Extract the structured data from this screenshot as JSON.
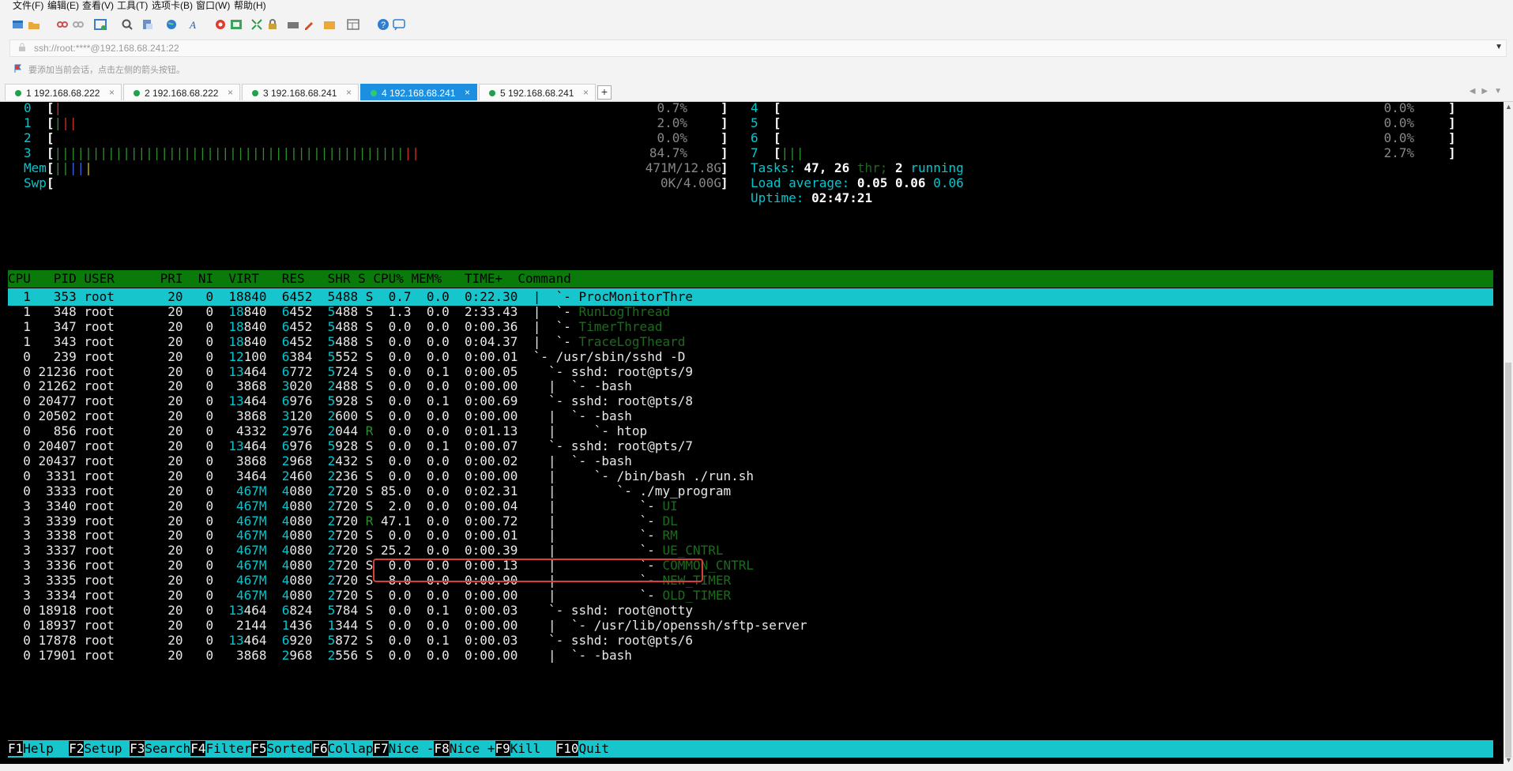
{
  "menu": [
    "文件(F)",
    "编辑(E)",
    "查看(V)",
    "工具(T)",
    "选项卡(B)",
    "窗口(W)",
    "帮助(H)"
  ],
  "address": {
    "text": "ssh://root:****@192.168.68.241:22"
  },
  "hint": "要添加当前会话，点击左侧的箭头按钮。",
  "tabs": [
    {
      "label": "1 192.168.68.222",
      "active": false
    },
    {
      "label": "2 192.168.68.222",
      "active": false
    },
    {
      "label": "3 192.168.68.241",
      "active": false
    },
    {
      "label": "4 192.168.68.241",
      "active": true
    },
    {
      "label": "5 192.168.68.241",
      "active": false
    }
  ],
  "close_glyph": "×",
  "add_tab_glyph": "+",
  "htop": {
    "cpus_left": [
      {
        "id": "0",
        "bars": 1,
        "color": "r",
        "value": "0.7%"
      },
      {
        "id": "1",
        "bars": 3,
        "color": "mix",
        "value": "2.0%"
      },
      {
        "id": "2",
        "bars": 0,
        "color": "g",
        "value": "0.0%"
      },
      {
        "id": "3",
        "bars": 48,
        "color": "g",
        "value": "84.7%"
      }
    ],
    "cpus_right": [
      {
        "id": "4",
        "value": "0.0%"
      },
      {
        "id": "5",
        "value": "0.0%"
      },
      {
        "id": "6",
        "value": "0.0%"
      },
      {
        "id": "7",
        "value": "2.7%"
      }
    ],
    "mem": {
      "label": "Mem",
      "value": "471M/12.8G"
    },
    "swp": {
      "label": "Swp",
      "value": "0K/4.00G"
    },
    "tasks": {
      "label": "Tasks:",
      "count": "47,",
      "threads": "26",
      "thr": "thr;",
      "running_count": "2",
      "running": "running"
    },
    "load": {
      "label": "Load average:",
      "l1": "0.05",
      "l5": "0.06",
      "l15": "0.06"
    },
    "uptime": {
      "label": "Uptime:",
      "value": "02:47:21"
    },
    "header": "CPU   PID USER      PRI  NI  VIRT   RES   SHR S CPU% MEM%   TIME+  Command",
    "rows": [
      {
        "cpu": "1",
        "pid": "353",
        "user": "root",
        "pri": "20",
        "ni": "0",
        "virt": "18840",
        "res": "6452",
        "shr": "5488",
        "s": "S",
        "cpuPct": "0.7",
        "mem": "0.0",
        "time": "0:22.30",
        "tree": "|  `- ",
        "cmd": "ProcMonitorThre",
        "cmdColor": "sel"
      },
      {
        "cpu": "1",
        "pid": "348",
        "user": "root",
        "pri": "20",
        "ni": "0",
        "virt": "18840",
        "res": "6452",
        "shr": "5488",
        "s": "S",
        "cpuPct": "1.3",
        "mem": "0.0",
        "time": "2:33.43",
        "tree": "|  `- ",
        "cmd": "RunLogThread",
        "cmdColor": "dg"
      },
      {
        "cpu": "1",
        "pid": "347",
        "user": "root",
        "pri": "20",
        "ni": "0",
        "virt": "18840",
        "res": "6452",
        "shr": "5488",
        "s": "S",
        "cpuPct": "0.0",
        "mem": "0.0",
        "time": "0:00.36",
        "tree": "|  `- ",
        "cmd": "TimerThread",
        "cmdColor": "dg"
      },
      {
        "cpu": "1",
        "pid": "343",
        "user": "root",
        "pri": "20",
        "ni": "0",
        "virt": "18840",
        "res": "6452",
        "shr": "5488",
        "s": "S",
        "cpuPct": "0.0",
        "mem": "0.0",
        "time": "0:04.37",
        "tree": "|  `- ",
        "cmd": "TraceLogTheard",
        "cmdColor": "dg"
      },
      {
        "cpu": "0",
        "pid": "239",
        "user": "root",
        "pri": "20",
        "ni": "0",
        "virt": "12100",
        "res": "6384",
        "shr": "5552",
        "s": "S",
        "cpuPct": "0.0",
        "mem": "0.0",
        "time": "0:00.01",
        "tree": "`- ",
        "cmd": "/usr/sbin/sshd -D",
        "cmdColor": "w"
      },
      {
        "cpu": "0",
        "pid": "21236",
        "user": "root",
        "pri": "20",
        "ni": "0",
        "virt": "13464",
        "res": "6772",
        "shr": "5724",
        "s": "S",
        "cpuPct": "0.0",
        "mem": "0.1",
        "time": "0:00.05",
        "tree": "  `- ",
        "cmd": "sshd: root@pts/9",
        "cmdColor": "w"
      },
      {
        "cpu": "0",
        "pid": "21262",
        "user": "root",
        "pri": "20",
        "ni": "0",
        "virt": "3868",
        "res": "3020",
        "shr": "2488",
        "s": "S",
        "cpuPct": "0.0",
        "mem": "0.0",
        "time": "0:00.00",
        "tree": "  |  `- ",
        "cmd": "-bash",
        "cmdColor": "w"
      },
      {
        "cpu": "0",
        "pid": "20477",
        "user": "root",
        "pri": "20",
        "ni": "0",
        "virt": "13464",
        "res": "6976",
        "shr": "5928",
        "s": "S",
        "cpuPct": "0.0",
        "mem": "0.1",
        "time": "0:00.69",
        "tree": "  `- ",
        "cmd": "sshd: root@pts/8",
        "cmdColor": "w"
      },
      {
        "cpu": "0",
        "pid": "20502",
        "user": "root",
        "pri": "20",
        "ni": "0",
        "virt": "3868",
        "res": "3120",
        "shr": "2600",
        "s": "S",
        "cpuPct": "0.0",
        "mem": "0.0",
        "time": "0:00.00",
        "tree": "  |  `- ",
        "cmd": "-bash",
        "cmdColor": "w"
      },
      {
        "cpu": "0",
        "pid": "856",
        "user": "root",
        "pri": "20",
        "ni": "0",
        "virt": "4332",
        "res": "2976",
        "shr": "2044",
        "s": "R",
        "cpuPct": "0.0",
        "mem": "0.0",
        "time": "0:01.13",
        "tree": "  |     `- ",
        "cmd": "htop",
        "cmdColor": "w"
      },
      {
        "cpu": "0",
        "pid": "20407",
        "user": "root",
        "pri": "20",
        "ni": "0",
        "virt": "13464",
        "res": "6976",
        "shr": "5928",
        "s": "S",
        "cpuPct": "0.0",
        "mem": "0.1",
        "time": "0:00.07",
        "tree": "  `- ",
        "cmd": "sshd: root@pts/7",
        "cmdColor": "w"
      },
      {
        "cpu": "0",
        "pid": "20437",
        "user": "root",
        "pri": "20",
        "ni": "0",
        "virt": "3868",
        "res": "2968",
        "shr": "2432",
        "s": "S",
        "cpuPct": "0.0",
        "mem": "0.0",
        "time": "0:00.02",
        "tree": "  |  `- ",
        "cmd": "-bash",
        "cmdColor": "w"
      },
      {
        "cpu": "0",
        "pid": "3331",
        "user": "root",
        "pri": "20",
        "ni": "0",
        "virt": "3464",
        "res": "2460",
        "shr": "2236",
        "s": "S",
        "cpuPct": "0.0",
        "mem": "0.0",
        "time": "0:00.00",
        "tree": "  |     `- ",
        "cmd": "/bin/bash ./run.sh",
        "cmdColor": "w"
      },
      {
        "cpu": "0",
        "pid": "3333",
        "user": "root",
        "pri": "20",
        "ni": "0",
        "virt": "467M",
        "res": "4080",
        "shr": "2720",
        "s": "S",
        "cpuPct": "85.0",
        "mem": "0.0",
        "time": "0:02.31",
        "tree": "  |        `- ",
        "cmd": "./my_program",
        "cmdColor": "w"
      },
      {
        "cpu": "3",
        "pid": "3340",
        "user": "root",
        "pri": "20",
        "ni": "0",
        "virt": "467M",
        "res": "4080",
        "shr": "2720",
        "s": "S",
        "cpuPct": "2.0",
        "mem": "0.0",
        "time": "0:00.04",
        "tree": "  |           `- ",
        "cmd": "UI",
        "cmdColor": "dg"
      },
      {
        "cpu": "3",
        "pid": "3339",
        "user": "root",
        "pri": "20",
        "ni": "0",
        "virt": "467M",
        "res": "4080",
        "shr": "2720",
        "s": "R",
        "cpuPct": "47.1",
        "mem": "0.0",
        "time": "0:00.72",
        "tree": "  |           `- ",
        "cmd": "DL",
        "cmdColor": "dg"
      },
      {
        "cpu": "3",
        "pid": "3338",
        "user": "root",
        "pri": "20",
        "ni": "0",
        "virt": "467M",
        "res": "4080",
        "shr": "2720",
        "s": "S",
        "cpuPct": "0.0",
        "mem": "0.0",
        "time": "0:00.01",
        "tree": "  |           `- ",
        "cmd": "RM",
        "cmdColor": "dg"
      },
      {
        "cpu": "3",
        "pid": "3337",
        "user": "root",
        "pri": "20",
        "ni": "0",
        "virt": "467M",
        "res": "4080",
        "shr": "2720",
        "s": "S",
        "cpuPct": "25.2",
        "mem": "0.0",
        "time": "0:00.39",
        "tree": "  |           `- ",
        "cmd": "UE_CNTRL",
        "cmdColor": "dg"
      },
      {
        "cpu": "3",
        "pid": "3336",
        "user": "root",
        "pri": "20",
        "ni": "0",
        "virt": "467M",
        "res": "4080",
        "shr": "2720",
        "s": "S",
        "cpuPct": "0.0",
        "mem": "0.0",
        "time": "0:00.13",
        "tree": "  |           `- ",
        "cmd": "COMMON_CNTRL",
        "cmdColor": "dg"
      },
      {
        "cpu": "3",
        "pid": "3335",
        "user": "root",
        "pri": "20",
        "ni": "0",
        "virt": "467M",
        "res": "4080",
        "shr": "2720",
        "s": "S",
        "cpuPct": "8.0",
        "mem": "0.0",
        "time": "0:00.90",
        "tree": "  |           `- ",
        "cmd": "NEW_TIMER",
        "cmdColor": "dg"
      },
      {
        "cpu": "3",
        "pid": "3334",
        "user": "root",
        "pri": "20",
        "ni": "0",
        "virt": "467M",
        "res": "4080",
        "shr": "2720",
        "s": "S",
        "cpuPct": "0.0",
        "mem": "0.0",
        "time": "0:00.00",
        "tree": "  |           `- ",
        "cmd": "OLD_TIMER",
        "cmdColor": "dg"
      },
      {
        "cpu": "0",
        "pid": "18918",
        "user": "root",
        "pri": "20",
        "ni": "0",
        "virt": "13464",
        "res": "6824",
        "shr": "5784",
        "s": "S",
        "cpuPct": "0.0",
        "mem": "0.1",
        "time": "0:00.03",
        "tree": "  `- ",
        "cmd": "sshd: root@notty",
        "cmdColor": "w"
      },
      {
        "cpu": "0",
        "pid": "18937",
        "user": "root",
        "pri": "20",
        "ni": "0",
        "virt": "2144",
        "res": "1436",
        "shr": "1344",
        "s": "S",
        "cpuPct": "0.0",
        "mem": "0.0",
        "time": "0:00.00",
        "tree": "  |  `- ",
        "cmd": "/usr/lib/openssh/sftp-server",
        "cmdColor": "w"
      },
      {
        "cpu": "0",
        "pid": "17878",
        "user": "root",
        "pri": "20",
        "ni": "0",
        "virt": "13464",
        "res": "6920",
        "shr": "5872",
        "s": "S",
        "cpuPct": "0.0",
        "mem": "0.1",
        "time": "0:00.03",
        "tree": "  `- ",
        "cmd": "sshd: root@pts/6",
        "cmdColor": "w"
      },
      {
        "cpu": "0",
        "pid": "17901",
        "user": "root",
        "pri": "20",
        "ni": "0",
        "virt": "3868",
        "res": "2968",
        "shr": "2556",
        "s": "S",
        "cpuPct": "0.0",
        "mem": "0.0",
        "time": "0:00.00",
        "tree": "  |  `- ",
        "cmd": "-bash",
        "cmdColor": "w"
      }
    ],
    "fkeys": [
      {
        "k": "F1",
        "l": "Help  "
      },
      {
        "k": "F2",
        "l": "Setup "
      },
      {
        "k": "F3",
        "l": "Search"
      },
      {
        "k": "F4",
        "l": "Filter"
      },
      {
        "k": "F5",
        "l": "Sorted"
      },
      {
        "k": "F6",
        "l": "Collap"
      },
      {
        "k": "F7",
        "l": "Nice -"
      },
      {
        "k": "F8",
        "l": "Nice +"
      },
      {
        "k": "F9",
        "l": "Kill  "
      },
      {
        "k": "F10",
        "l": "Quit"
      }
    ]
  }
}
